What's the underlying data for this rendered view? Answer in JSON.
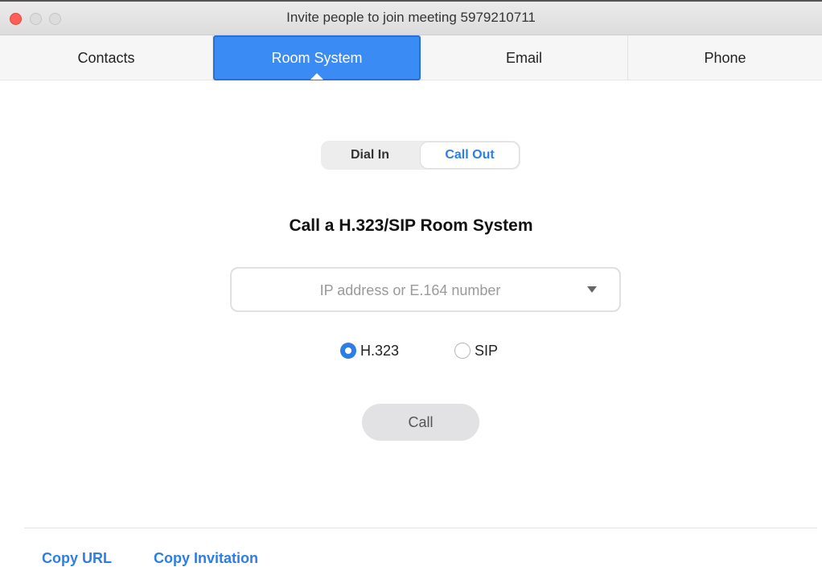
{
  "window": {
    "title": "Invite people to join meeting 5979210711"
  },
  "tabs": [
    {
      "label": "Contacts",
      "active": false
    },
    {
      "label": "Room System",
      "active": true
    },
    {
      "label": "Email",
      "active": false
    },
    {
      "label": "Phone",
      "active": false
    }
  ],
  "mode_toggle": {
    "options": [
      "Dial In",
      "Call Out"
    ],
    "selected": "Call Out"
  },
  "heading": "Call a H.323/SIP Room System",
  "address_field": {
    "placeholder": "IP address or E.164 number",
    "value": ""
  },
  "protocol": {
    "options": [
      "H.323",
      "SIP"
    ],
    "selected": "H.323"
  },
  "call_button": {
    "label": "Call"
  },
  "footer": {
    "copy_url": "Copy URL",
    "copy_invitation": "Copy Invitation"
  },
  "colors": {
    "accent": "#2d7de5",
    "active_tab": "#3b8bf5",
    "close_button": "#fe5f57"
  }
}
